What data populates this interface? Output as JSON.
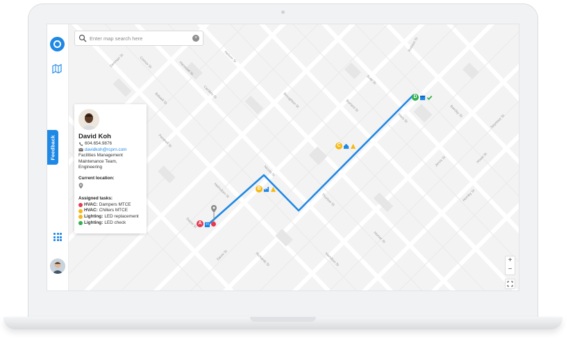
{
  "search": {
    "placeholder": "Enter map search here"
  },
  "rail": {
    "feedback_label": "Feedback"
  },
  "contact": {
    "name": "David Koh",
    "phone": "604.654.9876",
    "email": "davidkoh@rcprn.com",
    "department_line1": "Facilities Management",
    "department_line2": "Maintenance Team,",
    "department_line3": "Engineering",
    "location_heading": "Current location:",
    "tasks_heading": "Assigned tasks:",
    "tasks": [
      {
        "category": "HVAC:",
        "task": "Dampers MTCE",
        "color": "#e53950"
      },
      {
        "category": "HVAC:",
        "task": "Chillers MTCE",
        "color": "#f5b915"
      },
      {
        "category": "Lighting:",
        "task": "LED replacement",
        "color": "#f5b915"
      },
      {
        "category": "Lighting:",
        "task": "LED check",
        "color": "#34b04a"
      }
    ]
  },
  "markers": [
    {
      "letter": "A",
      "color": "#e53950"
    },
    {
      "letter": "B",
      "color": "#f5b915"
    },
    {
      "letter": "C",
      "color": "#f5b915"
    },
    {
      "letter": "D",
      "color": "#34b04a"
    }
  ],
  "zoom": {
    "in_label": "+",
    "out_label": "−"
  },
  "streets": [
    "Denman St",
    "Comox St",
    "Nelson St",
    "Robson St",
    "Haro St",
    "Barclay St",
    "Davie St",
    "Pendrell St",
    "Jervis St",
    "Bidwell St",
    "Harwood St",
    "Cardero St",
    "Nicola St",
    "Broughton St",
    "Thurlow St",
    "Burrard St",
    "Bute St",
    "Hornby St",
    "Howe St",
    "Seymour St",
    "Homer St",
    "Richards St",
    "Hamilton St",
    "Helmcken St",
    "Davie St"
  ],
  "colors": {
    "route": "#1e88e5",
    "accent": "#1e88e5"
  }
}
